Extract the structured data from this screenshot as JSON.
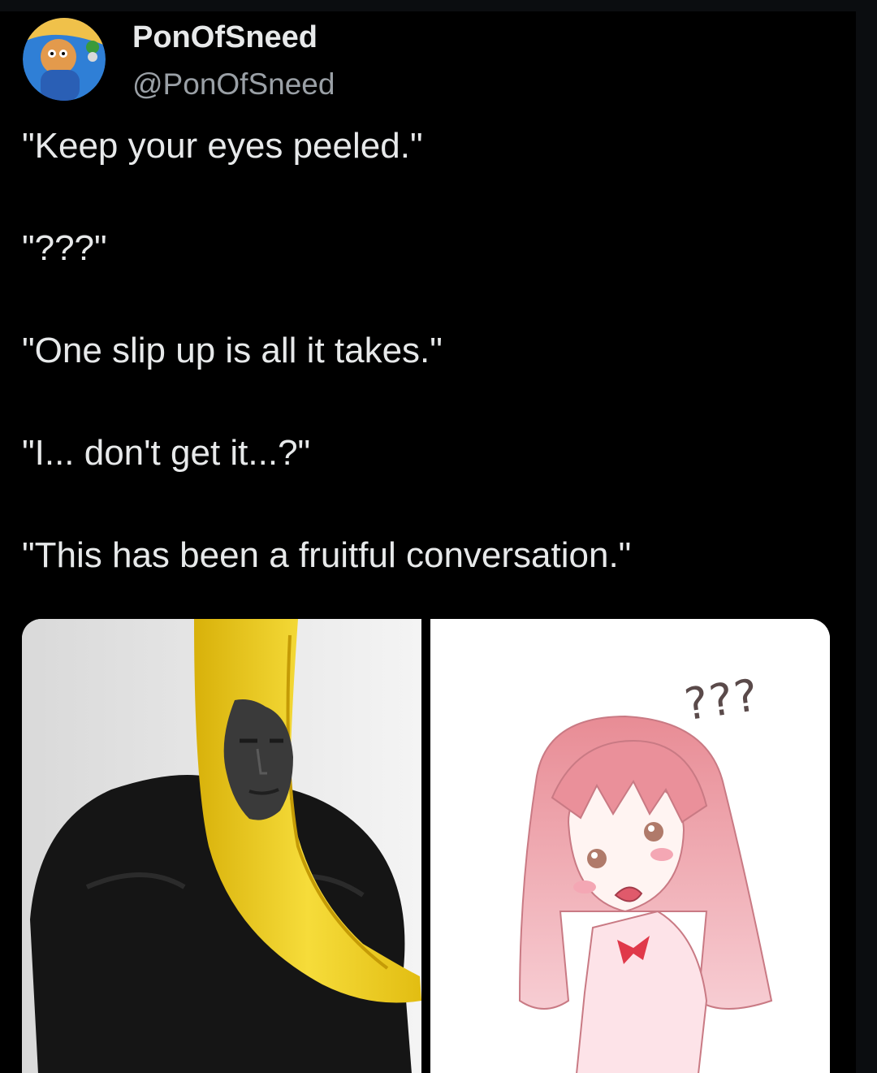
{
  "author": {
    "display_name": "PonOfSneed",
    "handle": "@PonOfSneed",
    "avatar_icon": "cartoon-avatar-icon"
  },
  "tweet": {
    "lines": [
      "\"Keep your eyes peeled.\"",
      "\"???\"",
      "\"One slip up is all it takes.\"",
      "\"I... don't get it...?\"",
      "\"This has been a fruitful conversation.\""
    ]
  },
  "media": {
    "left_image": "banana-gigachad-image",
    "right_image": "confused-anime-girl-image",
    "right_caption": "???"
  },
  "colors": {
    "background": "#000000",
    "text": "#e7e9ea",
    "handle": "#9aa0a6",
    "banana": "#f2d22e"
  }
}
